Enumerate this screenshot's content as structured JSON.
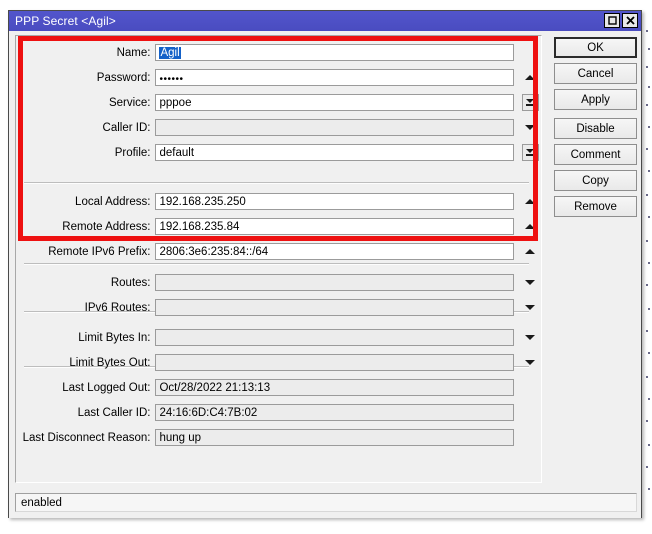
{
  "window": {
    "title": "PPP Secret <Agil>",
    "buttons": {
      "maximize": "maximize-icon",
      "close": "close-icon"
    }
  },
  "form": {
    "rows": [
      {
        "label": "Name:",
        "value": "Agil",
        "state": "editable-selected",
        "control": "none"
      },
      {
        "label": "Password:",
        "value": "••••••",
        "state": "editable",
        "control": "tri-up"
      },
      {
        "label": "Service:",
        "value": "pppoe",
        "state": "editable",
        "control": "combo"
      },
      {
        "label": "Caller ID:",
        "value": "",
        "state": "disabled",
        "control": "tri-down"
      },
      {
        "label": "Profile:",
        "value": "default",
        "state": "editable",
        "control": "combo"
      },
      {
        "label": "Local Address:",
        "value": "192.168.235.250",
        "state": "editable",
        "control": "tri-up"
      },
      {
        "label": "Remote Address:",
        "value": "192.168.235.84",
        "state": "editable",
        "control": "tri-up"
      },
      {
        "label": "Remote IPv6 Prefix:",
        "value": "2806:3e6:235:84::/64",
        "state": "editable",
        "control": "tri-up"
      },
      {
        "label": "Routes:",
        "value": "",
        "state": "disabled",
        "control": "tri-down"
      },
      {
        "label": "IPv6 Routes:",
        "value": "",
        "state": "disabled",
        "control": "tri-down"
      },
      {
        "label": "Limit Bytes In:",
        "value": "",
        "state": "disabled",
        "control": "tri-down"
      },
      {
        "label": "Limit Bytes Out:",
        "value": "",
        "state": "disabled",
        "control": "tri-down"
      },
      {
        "label": "Last Logged Out:",
        "value": "Oct/28/2022 21:13:13",
        "state": "readonly",
        "control": "none"
      },
      {
        "label": "Last Caller ID:",
        "value": "24:16:6D:C4:7B:02",
        "state": "readonly",
        "control": "none"
      },
      {
        "label": "Last Disconnect Reason:",
        "value": "hung up",
        "state": "readonly",
        "control": "none"
      }
    ]
  },
  "actions": {
    "ok": "OK",
    "cancel": "Cancel",
    "apply": "Apply",
    "disable": "Disable",
    "comment": "Comment",
    "copy": "Copy",
    "remove": "Remove"
  },
  "status": {
    "text": "enabled"
  },
  "annotation": {
    "type": "highlight-rectangle",
    "color": "#ee1111"
  }
}
